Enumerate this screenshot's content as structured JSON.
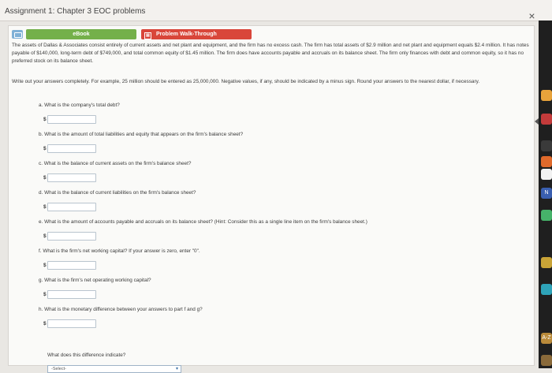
{
  "window": {
    "title": "Assignment 1: Chapter 3 EOC problems",
    "close_glyph": "×"
  },
  "tabs": {
    "ebook": "eBook",
    "walkthrough": "Problem Walk-Through",
    "walk_icon_glyph": "▤"
  },
  "problem": {
    "paragraph": "The assets of Dallas & Associates consist entirely of current assets and net plant and equipment, and the firm has no excess cash. The firm has total assets of $2.9 million and net plant and equipment equals $2.4 million. It has notes payable of $140,000, long-term debt of $749,000, and total common equity of $1.45 million. The firm does have accounts payable and accruals on its balance sheet. The firm only finances with debt and common equity, so it has no preferred stock on its balance sheet.",
    "instructions": "Write out your answers completely. For example, 25 million should be entered as 25,000,000. Negative values, if any, should be indicated by a minus sign. Round your answers to the nearest dollar, if necessary."
  },
  "questions": [
    {
      "label": "a. What is the company's total debt?",
      "prefix": "$"
    },
    {
      "label": "b. What is the amount of total liabilities and equity that appears on the firm's balance sheet?",
      "prefix": "$"
    },
    {
      "label": "c. What is the balance of current assets on the firm's balance sheet?",
      "prefix": "$"
    },
    {
      "label": "d. What is the balance of current liabilities on the firm's balance sheet?",
      "prefix": "$"
    },
    {
      "label": "e. What is the amount of accounts payable and accruals on its balance sheet? (Hint: Consider this as a single line item on the firm's balance sheet.)",
      "prefix": "$"
    },
    {
      "label": "f. What is the firm's net working capital? If your answer is zero, enter \"0\".",
      "prefix": "$"
    },
    {
      "label": "g. What is the firm's net operating working capital?",
      "prefix": "$"
    },
    {
      "label": "h. What is the monetary difference between your answers to part f and g?",
      "prefix": "$"
    }
  ],
  "difference_question": "What does this difference indicate?",
  "dropdown": {
    "selected": "-Select-"
  },
  "tray": [
    {
      "name": "tray-colorful-icon",
      "color": "#e8a33b",
      "glyph": ""
    },
    {
      "name": "tray-red-dot-icon",
      "color": "#c43b3b",
      "glyph": ""
    },
    {
      "name": "tray-dark-icon",
      "color": "#3a3a3a",
      "glyph": ""
    },
    {
      "name": "tray-orange-icon",
      "color": "#e06a2b",
      "glyph": ""
    },
    {
      "name": "tray-white-icon",
      "color": "#f2f2f2",
      "glyph": ""
    },
    {
      "name": "tray-n-icon",
      "color": "#3a5fb0",
      "glyph": "N"
    },
    {
      "name": "tray-c-icon",
      "color": "#46b36a",
      "glyph": ""
    },
    {
      "name": "tray-gold-icon",
      "color": "#c9a437",
      "glyph": ""
    },
    {
      "name": "tray-teal-icon",
      "color": "#2ea3b8",
      "glyph": ""
    },
    {
      "name": "tray-az-icon",
      "color": "#b98a3a",
      "glyph": "A-Z"
    },
    {
      "name": "tray-bottom-icon",
      "color": "#8a6a3a",
      "glyph": ""
    }
  ]
}
